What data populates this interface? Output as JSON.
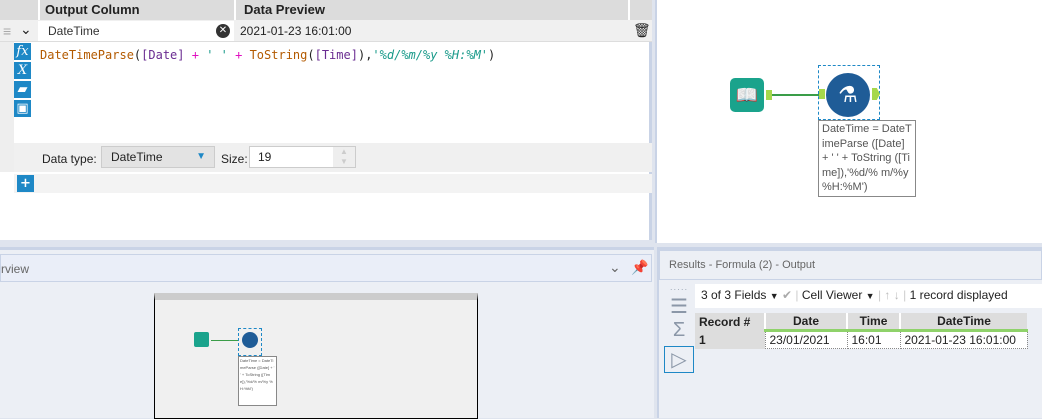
{
  "config": {
    "headers": {
      "output_column": "Output Column",
      "data_preview": "Data Preview"
    },
    "row": {
      "column_name": "DateTime",
      "preview": "2021-01-23 16:01:00"
    },
    "expression": {
      "fn1": "DateTimeParse",
      "p1": "(",
      "f1": "[Date]",
      "op1": " + ",
      "str1": "' '",
      "op2": " + ",
      "fn2": "ToString",
      "p2": "(",
      "f2": "[Time]",
      "p3": "),",
      "fmt": "'%d/%m/%y %H:%M'",
      "p4": ")"
    },
    "data_type_label": "Data type:",
    "data_type": "DateTime",
    "size_label": "Size:",
    "size": "19",
    "side_icons": {
      "fx": "fx",
      "var": "X"
    },
    "add": "+"
  },
  "canvas": {
    "annotation": "DateTime = DateTimeParse ([Date] + ' ' + ToString ([Time]),'%d/% m/%y %H:%M')"
  },
  "overview": {
    "title": "rview"
  },
  "results": {
    "title": "Results - Formula (2) - Output",
    "fields": "3 of 3 Fields",
    "viewer": "Cell Viewer",
    "records": "1 record displayed",
    "columns": [
      "Record #",
      "Date",
      "Time",
      "DateTime"
    ],
    "rows": [
      [
        "1",
        "23/01/2021",
        "16:01",
        "2021-01-23 16:01:00"
      ]
    ]
  },
  "colors": {
    "accent": "#1e88c6",
    "green": "#8fd26a"
  }
}
